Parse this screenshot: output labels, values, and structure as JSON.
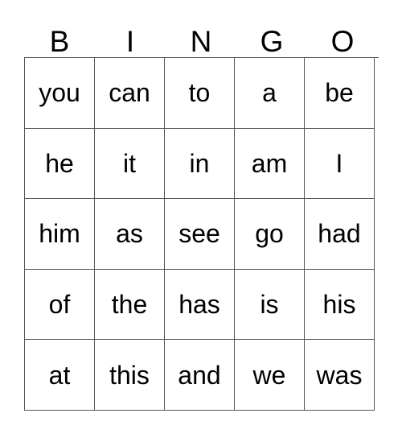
{
  "card": {
    "title_letters": [
      "B",
      "I",
      "N",
      "G",
      "O"
    ],
    "grid_rows": [
      [
        "you",
        "can",
        "to",
        "a",
        "be"
      ],
      [
        "he",
        "it",
        "in",
        "am",
        "I"
      ],
      [
        "him",
        "as",
        "see",
        "go",
        "had"
      ],
      [
        "of",
        "the",
        "has",
        "is",
        "his"
      ],
      [
        "at",
        "this",
        "and",
        "we",
        "was"
      ]
    ],
    "colors": {
      "text": "#000000",
      "border": "#555555",
      "background": "#ffffff"
    }
  }
}
